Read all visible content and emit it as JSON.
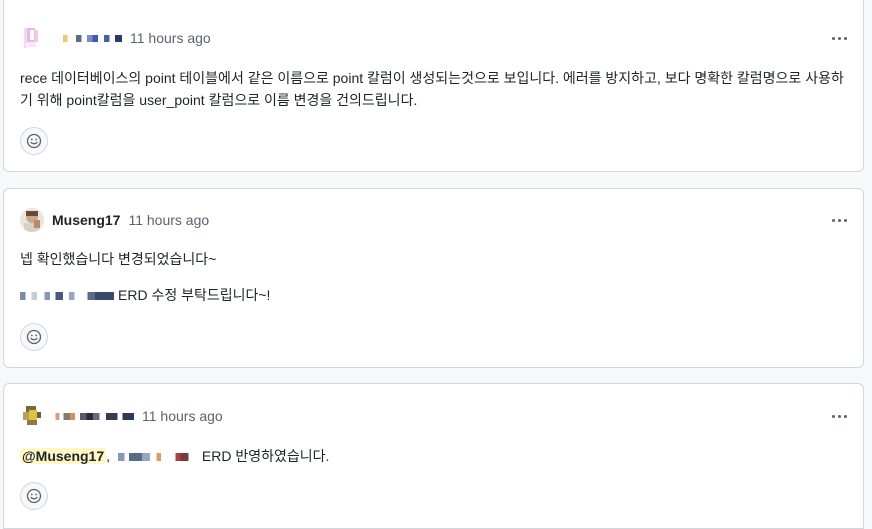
{
  "comments": [
    {
      "author": "",
      "time": "11 hours ago",
      "paragraphs": [
        "rece 데이터베이스의 point 테이블에서 같은 이름으로 point 칼럼이 생성되는것으로 보입니다. 에러를 방지하고, 보다 명확한 칼럼명으로 사용하기 위해 point칼럼을 user_point 칼럼으로 이름 변경을 건의드립니다."
      ]
    },
    {
      "author": "Museng17",
      "time": "11 hours ago",
      "paragraphs": [
        "넵 확인했습니다 변경되었습니다~",
        "ERD 수정 부탁드립니다~!"
      ]
    },
    {
      "author": "",
      "time": "11 hours ago",
      "mention": "@Museng17",
      "separator": ",",
      "paragraphs": [
        "ERD 반영하였습니다."
      ]
    }
  ],
  "icons": {
    "more": "kebab-horizontal-icon",
    "reaction": "smiley-icon"
  },
  "colors": {
    "border": "#d0d7de",
    "muted": "#59636e",
    "mention_bg": "#fff8c5"
  }
}
